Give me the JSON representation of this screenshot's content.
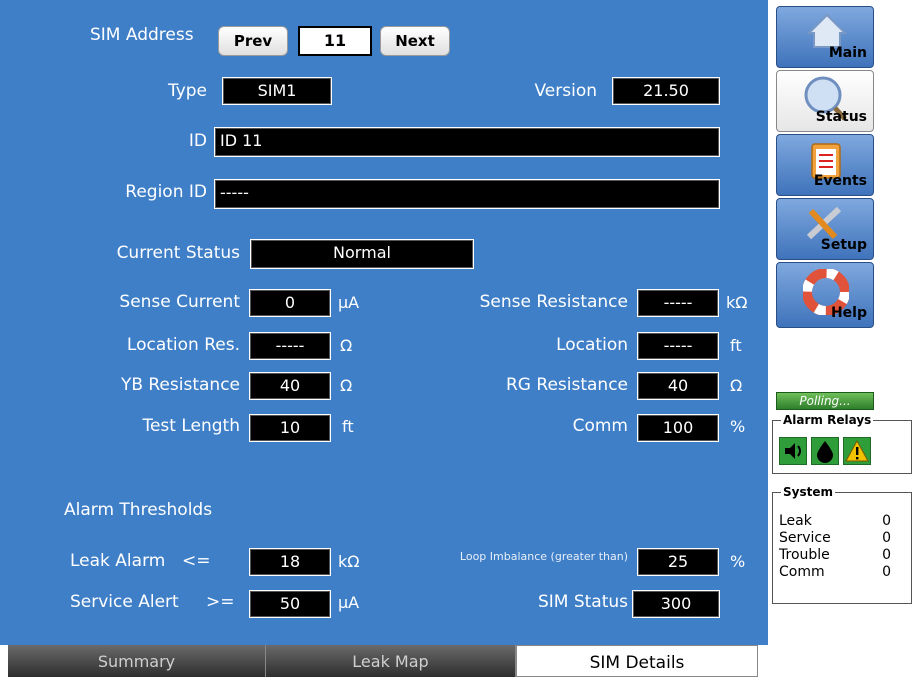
{
  "sim_address": {
    "label": "SIM Address",
    "prev": "Prev",
    "value": "11",
    "next": "Next"
  },
  "type": {
    "label": "Type",
    "value": "SIM1"
  },
  "version": {
    "label": "Version",
    "value": "21.50"
  },
  "id": {
    "label": "ID",
    "value": "ID 11"
  },
  "region_id": {
    "label": "Region ID",
    "value": "-----"
  },
  "current_status": {
    "label": "Current Status",
    "value": "Normal"
  },
  "sense_current": {
    "label": "Sense Current",
    "value": "0",
    "unit": "µA"
  },
  "sense_resistance": {
    "label": "Sense Resistance",
    "value": "-----",
    "unit": "kΩ"
  },
  "location_res": {
    "label": "Location Res.",
    "value": "-----",
    "unit": "Ω"
  },
  "location": {
    "label": "Location",
    "value": "-----",
    "unit": "ft"
  },
  "yb_resistance": {
    "label": "YB Resistance",
    "value": "40",
    "unit": "Ω"
  },
  "rg_resistance": {
    "label": "RG Resistance",
    "value": "40",
    "unit": "Ω"
  },
  "test_length": {
    "label": "Test Length",
    "value": "10",
    "unit": "ft"
  },
  "comm": {
    "label": "Comm",
    "value": "100",
    "unit": "%"
  },
  "alarm_thresholds": {
    "heading": "Alarm Thresholds"
  },
  "leak_alarm": {
    "label": "Leak Alarm",
    "op": "<=",
    "value": "18",
    "unit": "kΩ"
  },
  "service_alert": {
    "label": "Service Alert",
    "op": ">=",
    "value": "50",
    "unit": "µA"
  },
  "loop_imbalance": {
    "label": "Loop Imbalance (greater than)",
    "value": "25",
    "unit": "%"
  },
  "sim_status": {
    "label": "SIM Status",
    "value": "300"
  },
  "sidebar": {
    "nav": [
      {
        "label": "Main",
        "icon": "home-icon"
      },
      {
        "label": "Status",
        "icon": "magnifier-icon",
        "selected": true
      },
      {
        "label": "Events",
        "icon": "clipboard-icon"
      },
      {
        "label": "Setup",
        "icon": "tools-icon"
      },
      {
        "label": "Help",
        "icon": "lifebuoy-icon"
      }
    ],
    "polling": "Polling...",
    "alarm_relays": {
      "title": "Alarm Relays",
      "icons": [
        "speaker-icon",
        "drop-icon",
        "warning-icon"
      ]
    },
    "system": {
      "title": "System",
      "rows": [
        {
          "label": "Leak",
          "value": "0"
        },
        {
          "label": "Service",
          "value": "0"
        },
        {
          "label": "Trouble",
          "value": "0"
        },
        {
          "label": "Comm",
          "value": "0"
        }
      ]
    }
  },
  "tabs": [
    {
      "label": "Summary"
    },
    {
      "label": "Leak Map"
    },
    {
      "label": "SIM Details",
      "selected": true
    }
  ],
  "colors": {
    "panel": "#3f7fc8",
    "field": "#000000",
    "relay_green": "#2f9d3a",
    "warning_yellow": "#f2c200"
  }
}
